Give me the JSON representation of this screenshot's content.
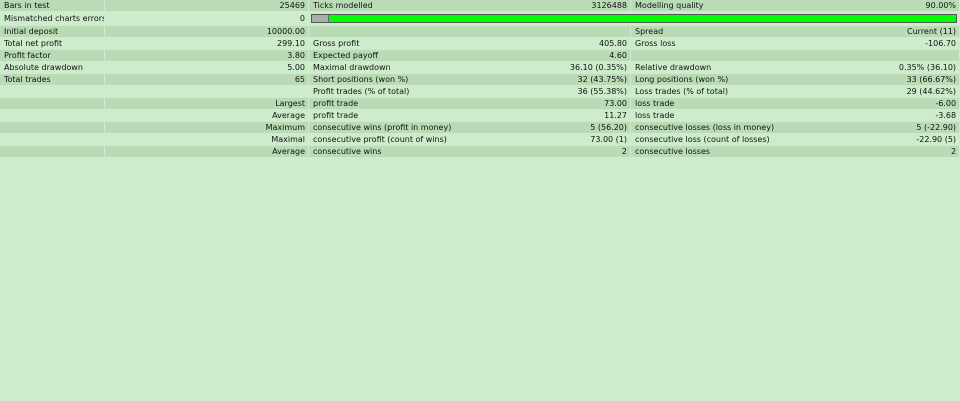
{
  "r0": {
    "c1": "Bars in test",
    "c2": "25469",
    "c3": "Ticks modelled",
    "c4": "3126488",
    "c5": "Modelling quality",
    "c6": "90.00%"
  },
  "r1": {
    "c1": "Mismatched charts errors",
    "c2": "0"
  },
  "r2": {
    "c1": "Initial deposit",
    "c2": "10000.00",
    "c5": "Spread",
    "c6": "Current (11)"
  },
  "r3": {
    "c1": "Total net profit",
    "c2": "299.10",
    "c3": "Gross profit",
    "c4": "405.80",
    "c5": "Gross loss",
    "c6": "-106.70"
  },
  "r4": {
    "c1": "Profit factor",
    "c2": "3.80",
    "c3": "Expected payoff",
    "c4": "4.60"
  },
  "r5": {
    "c1": "Absolute drawdown",
    "c2": "5.00",
    "c3": "Maximal drawdown",
    "c4": "36.10 (0.35%)",
    "c5": "Relative drawdown",
    "c6": "0.35% (36.10)"
  },
  "r6": {
    "c1": "Total trades",
    "c2": "65",
    "c3": "Short positions (won %)",
    "c4": "32 (43.75%)",
    "c5": "Long positions (won %)",
    "c6": "33 (66.67%)"
  },
  "r7": {
    "c3": "Profit trades (% of total)",
    "c4": "36 (55.38%)",
    "c5": "Loss trades (% of total)",
    "c6": "29 (44.62%)"
  },
  "r8": {
    "c2": "Largest",
    "c3": "profit trade",
    "c4": "73.00",
    "c5": "loss trade",
    "c6": "-6.00"
  },
  "r9": {
    "c2": "Average",
    "c3": "profit trade",
    "c4": "11.27",
    "c5": "loss trade",
    "c6": "-3.68"
  },
  "r10": {
    "c2": "Maximum",
    "c3": "consecutive wins (profit in money)",
    "c4": "5 (56.20)",
    "c5": "consecutive losses (loss in money)",
    "c6": "5 (-22.90)"
  },
  "r11": {
    "c2": "Maximal",
    "c3": "consecutive profit (count of wins)",
    "c4": "73.00 (1)",
    "c5": "consecutive loss (count of losses)",
    "c6": "-22.90 (5)"
  },
  "r12": {
    "c2": "Average",
    "c3": "consecutive wins",
    "c4": "2",
    "c5": "consecutive losses",
    "c6": "2"
  },
  "modelling_quality_bar": {
    "value_percent": 90.0,
    "fill_color": "#00ff00",
    "empty_color": "#a5b0a6"
  },
  "colors": {
    "background": "#cdeccb",
    "row_shade": "#b9dcb6"
  }
}
